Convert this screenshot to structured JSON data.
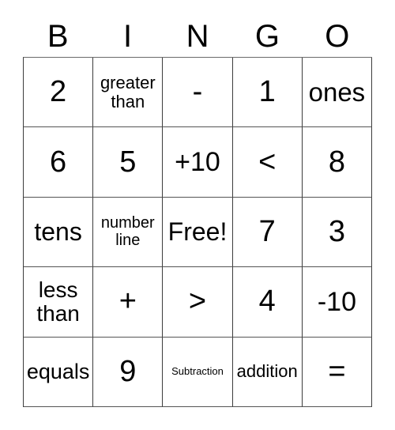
{
  "card": {
    "title": "BINGO",
    "headers": [
      "B",
      "I",
      "N",
      "G",
      "O"
    ],
    "free_space_label": "Free!",
    "border_color": "#3d3d3d",
    "text_color": "#000000",
    "background_color": "#ffffff",
    "rows": [
      [
        {
          "text": "2",
          "size": "fs-xl"
        },
        {
          "text": "greater than",
          "size": "fs-sm"
        },
        {
          "text": "-",
          "size": "fs-xl"
        },
        {
          "text": "1",
          "size": "fs-xl"
        },
        {
          "text": "ones",
          "size": "fs-ones"
        }
      ],
      [
        {
          "text": "6",
          "size": "fs-xl"
        },
        {
          "text": "5",
          "size": "fs-xl"
        },
        {
          "text": "+10",
          "size": "fs-lg"
        },
        {
          "text": "<",
          "size": "fs-xl"
        },
        {
          "text": "8",
          "size": "fs-xl"
        }
      ],
      [
        {
          "text": "tens",
          "size": "fs-free"
        },
        {
          "text": "number line",
          "size": "fs-xs"
        },
        {
          "text": "Free!",
          "size": "fs-free"
        },
        {
          "text": "7",
          "size": "fs-xl"
        },
        {
          "text": "3",
          "size": "fs-xl"
        }
      ],
      [
        {
          "text": "less than",
          "size": "fs-md"
        },
        {
          "text": "+",
          "size": "fs-xl"
        },
        {
          "text": ">",
          "size": "fs-xl"
        },
        {
          "text": "4",
          "size": "fs-xl"
        },
        {
          "text": "-10",
          "size": "fs-lg"
        }
      ],
      [
        {
          "text": "equals",
          "size": "fs-eq"
        },
        {
          "text": "9",
          "size": "fs-xl"
        },
        {
          "text": "Subtraction",
          "size": "fs-tiny"
        },
        {
          "text": "addition",
          "size": "fs-sm"
        },
        {
          "text": "=",
          "size": "fs-xl"
        }
      ]
    ]
  }
}
